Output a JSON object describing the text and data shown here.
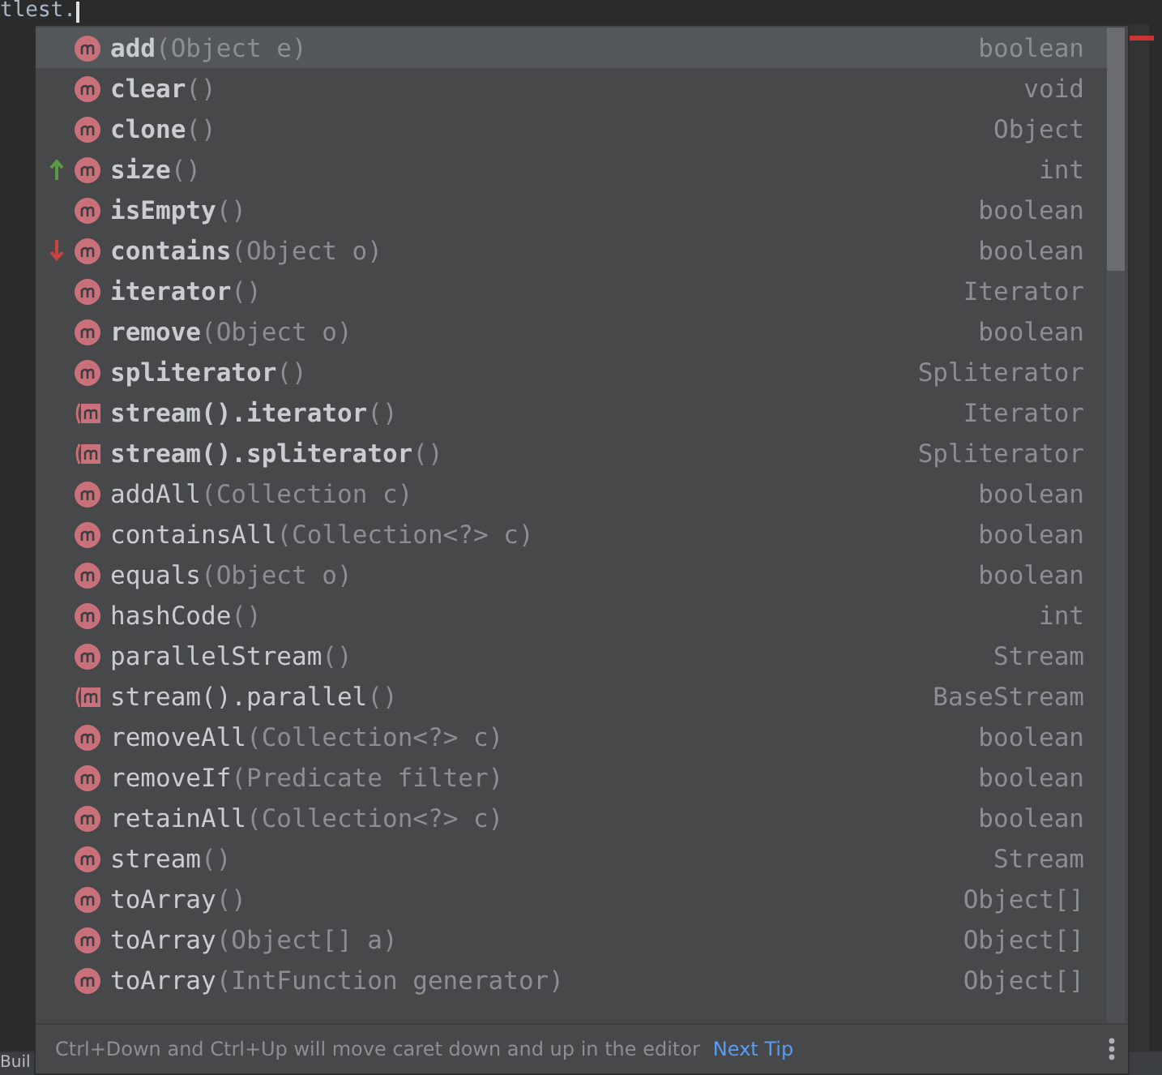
{
  "editor": {
    "code_text": "tlest.",
    "status_text": "Buil"
  },
  "completion": {
    "items": [
      {
        "name": "add",
        "params": "(Object e)",
        "type": "boolean",
        "kind": "method",
        "bold": true,
        "selected": true,
        "moved_up": false,
        "moved_down": false
      },
      {
        "name": "clear",
        "params": "()",
        "type": "void",
        "kind": "method",
        "bold": true,
        "selected": false,
        "moved_up": false,
        "moved_down": false
      },
      {
        "name": "clone",
        "params": "()",
        "type": "Object",
        "kind": "method",
        "bold": true,
        "selected": false,
        "moved_up": false,
        "moved_down": false
      },
      {
        "name": "size",
        "params": "()",
        "type": "int",
        "kind": "method",
        "bold": true,
        "selected": false,
        "moved_up": true,
        "moved_down": false
      },
      {
        "name": "isEmpty",
        "params": "()",
        "type": "boolean",
        "kind": "method",
        "bold": true,
        "selected": false,
        "moved_up": false,
        "moved_down": false
      },
      {
        "name": "contains",
        "params": "(Object o)",
        "type": "boolean",
        "kind": "method",
        "bold": true,
        "selected": false,
        "moved_up": false,
        "moved_down": true
      },
      {
        "name": "iterator",
        "params": "()",
        "type": "Iterator",
        "kind": "method",
        "bold": true,
        "selected": false,
        "moved_up": false,
        "moved_down": false
      },
      {
        "name": "remove",
        "params": "(Object o)",
        "type": "boolean",
        "kind": "method",
        "bold": true,
        "selected": false,
        "moved_up": false,
        "moved_down": false
      },
      {
        "name": "spliterator",
        "params": "()",
        "type": "Spliterator",
        "kind": "method",
        "bold": true,
        "selected": false,
        "moved_up": false,
        "moved_down": false
      },
      {
        "name": "stream().iterator",
        "params": "()",
        "type": "Iterator",
        "kind": "chained",
        "bold": true,
        "selected": false,
        "moved_up": false,
        "moved_down": false
      },
      {
        "name": "stream().spliterator",
        "params": "()",
        "type": "Spliterator",
        "kind": "chained",
        "bold": true,
        "selected": false,
        "moved_up": false,
        "moved_down": false
      },
      {
        "name": "addAll",
        "params": "(Collection c)",
        "type": "boolean",
        "kind": "method",
        "bold": false,
        "selected": false,
        "moved_up": false,
        "moved_down": false
      },
      {
        "name": "containsAll",
        "params": "(Collection<?> c)",
        "type": "boolean",
        "kind": "method",
        "bold": false,
        "selected": false,
        "moved_up": false,
        "moved_down": false
      },
      {
        "name": "equals",
        "params": "(Object o)",
        "type": "boolean",
        "kind": "method",
        "bold": false,
        "selected": false,
        "moved_up": false,
        "moved_down": false
      },
      {
        "name": "hashCode",
        "params": "()",
        "type": "int",
        "kind": "method",
        "bold": false,
        "selected": false,
        "moved_up": false,
        "moved_down": false
      },
      {
        "name": "parallelStream",
        "params": "()",
        "type": "Stream",
        "kind": "method",
        "bold": false,
        "selected": false,
        "moved_up": false,
        "moved_down": false
      },
      {
        "name": "stream().parallel",
        "params": "()",
        "type": "BaseStream",
        "kind": "chained",
        "bold": false,
        "selected": false,
        "moved_up": false,
        "moved_down": false
      },
      {
        "name": "removeAll",
        "params": "(Collection<?> c)",
        "type": "boolean",
        "kind": "method",
        "bold": false,
        "selected": false,
        "moved_up": false,
        "moved_down": false
      },
      {
        "name": "removeIf",
        "params": "(Predicate filter)",
        "type": "boolean",
        "kind": "method",
        "bold": false,
        "selected": false,
        "moved_up": false,
        "moved_down": false
      },
      {
        "name": "retainAll",
        "params": "(Collection<?> c)",
        "type": "boolean",
        "kind": "method",
        "bold": false,
        "selected": false,
        "moved_up": false,
        "moved_down": false
      },
      {
        "name": "stream",
        "params": "()",
        "type": "Stream",
        "kind": "method",
        "bold": false,
        "selected": false,
        "moved_up": false,
        "moved_down": false
      },
      {
        "name": "toArray",
        "params": "()",
        "type": "Object[]",
        "kind": "method",
        "bold": false,
        "selected": false,
        "moved_up": false,
        "moved_down": false
      },
      {
        "name": "toArray",
        "params": "(Object[] a)",
        "type": "Object[]",
        "kind": "method",
        "bold": false,
        "selected": false,
        "moved_up": false,
        "moved_down": false
      },
      {
        "name": "toArray",
        "params": "(IntFunction generator)",
        "type": "Object[]",
        "kind": "method",
        "bold": false,
        "selected": false,
        "moved_up": false,
        "moved_down": false
      }
    ],
    "footer": {
      "hint": "Ctrl+Down and Ctrl+Up will move caret down and up in the editor",
      "link": "Next Tip"
    }
  }
}
